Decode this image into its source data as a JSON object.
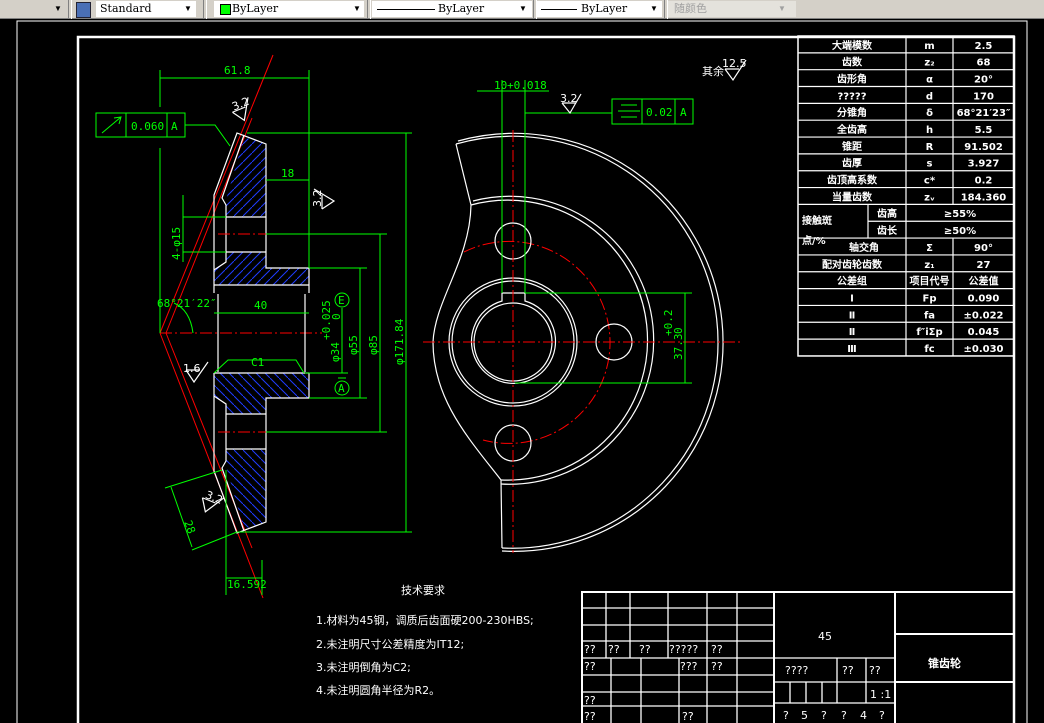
{
  "toolbar": {
    "text_style": "Standard",
    "layer_color": "ByLayer",
    "linetype": "ByLayer",
    "lineweight": "ByLayer",
    "plot_style": "随颜色",
    "layer_color_swatch": "#00ff00"
  },
  "left_view": {
    "dim_length": "61.8",
    "dim_18": "18",
    "dim_holes": "4-φ15",
    "dim_angle": "68°21′22″",
    "dim_40": "40",
    "chamfer": "C1",
    "dim_bore": "φ34",
    "dim_bore_tol_upper": "+0.025",
    "dim_bore_tol_lower": "0",
    "dim_55": "φ55",
    "dim_85": "φ85",
    "dim_171": "φ171.84",
    "dim_28": "28",
    "dim_16592": "16.592",
    "runout_value": "0.060",
    "runout_datum": "A",
    "datum_label": "A",
    "envelope_label": "E",
    "roughness_1": "1.6",
    "roughness_2": "3.2",
    "roughness_3": "3.2",
    "roughness_4": "3.2"
  },
  "right_view": {
    "key_width": "10",
    "key_tol": "+0.018",
    "roughness": "3.2",
    "symmetry_value": "0.02",
    "symmetry_datum": "A",
    "dim_key_depth": "37.3",
    "dim_key_tol_upper": "+0.2",
    "dim_key_tol_lower": "0",
    "rest_label": "其余",
    "rest_roughness": "12.5"
  },
  "param_table": {
    "rows": [
      {
        "label": "大端模数",
        "symbol": "m",
        "value": "2.5"
      },
      {
        "label": "齿数",
        "symbol": "z₂",
        "value": "68"
      },
      {
        "label": "齿形角",
        "symbol": "α",
        "value": "20°"
      },
      {
        "label": "?????",
        "symbol": "d",
        "value": "170"
      },
      {
        "label": "分锥角",
        "symbol": "δ",
        "value": "68°21′23″"
      },
      {
        "label": "全齿高",
        "symbol": "h",
        "value": "5.5"
      },
      {
        "label": "锥距",
        "symbol": "R",
        "value": "91.502"
      },
      {
        "label": "齿厚",
        "symbol": "s",
        "value": "3.927"
      },
      {
        "label": "齿顶高系数",
        "symbol": "c*",
        "value": "0.2"
      },
      {
        "label": "当量齿数",
        "symbol": "zᵥ",
        "value": "184.360"
      },
      {
        "label": "齿高",
        "symbol": "",
        "value": "≥55%"
      },
      {
        "label": "齿长",
        "symbol": "",
        "value": "≥50%"
      },
      {
        "label": "轴交角",
        "symbol": "Σ",
        "value": "90°"
      },
      {
        "label": "配对齿轮齿数",
        "symbol": "z₁",
        "value": "27"
      },
      {
        "label": "公差组",
        "symbol": "项目代号",
        "value": "公差值"
      },
      {
        "label": "Ⅰ",
        "symbol": "Fp",
        "value": "0.090"
      },
      {
        "label": "Ⅱ",
        "symbol": "fa",
        "value": "±0.022"
      },
      {
        "label": "Ⅱ",
        "symbol": "f″iΣp",
        "value": "0.045"
      },
      {
        "label": "Ⅲ",
        "symbol": "fc",
        "value": "±0.030"
      }
    ],
    "contact_label_1": "接触斑",
    "contact_label_2": "点/%"
  },
  "tech_requirements": {
    "title": "技术要求",
    "items": [
      "1.材料为45钢，调质后齿面硬200-230HBS;",
      "2.未注明尺寸公差精度为IT12;",
      "3.未注明倒角为C2;",
      "4.未注明圆角半径为R2。"
    ]
  },
  "title_block": {
    "material": "45",
    "part_name": "锥齿轮",
    "scale": "1 :1",
    "r1": [
      "??",
      "??",
      "??",
      "?????",
      "??"
    ],
    "r2": [
      "??",
      "???",
      "??"
    ],
    "r3": [
      "??"
    ],
    "r4": [
      "??",
      "??"
    ],
    "stage": "????",
    "weight": "??",
    "ratio": "??",
    "sheet": [
      "?",
      "5",
      "?",
      "?",
      "4",
      "?"
    ]
  }
}
